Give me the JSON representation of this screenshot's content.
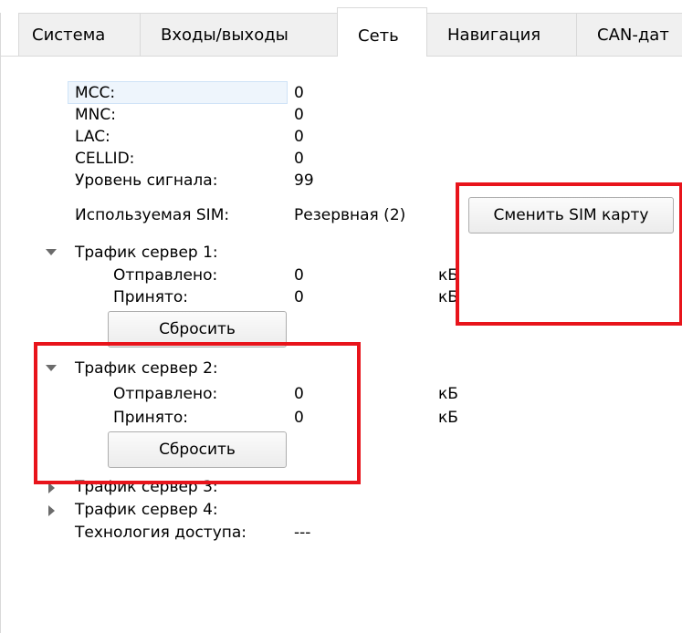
{
  "tabs": [
    {
      "label": "Система",
      "active": false
    },
    {
      "label": "Входы/выходы",
      "active": false
    },
    {
      "label": "Сеть",
      "active": true
    },
    {
      "label": "Навигация",
      "active": false
    },
    {
      "label": "CAN-дат",
      "active": false
    }
  ],
  "network": {
    "mcc": {
      "label": "MCC:",
      "value": "0"
    },
    "mnc": {
      "label": "MNC:",
      "value": "0"
    },
    "lac": {
      "label": "LAC:",
      "value": "0"
    },
    "cellid": {
      "label": "CELLID:",
      "value": "0"
    },
    "signal": {
      "label": "Уровень сигнала:",
      "value": "99"
    },
    "sim": {
      "label": "Используемая SIM:",
      "value": "Резервная (2)",
      "button": "Сменить SIM карту"
    }
  },
  "traffic": [
    {
      "title": "Трафик сервер 1:",
      "expanded": true,
      "sent_label": "Отправлено:",
      "sent_value": "0",
      "sent_unit": "кБ",
      "recv_label": "Принято:",
      "recv_value": "0",
      "recv_unit": "кБ",
      "reset": "Сбросить"
    },
    {
      "title": "Трафик сервер 2:",
      "expanded": true,
      "sent_label": "Отправлено:",
      "sent_value": "0",
      "sent_unit": "кБ",
      "recv_label": "Принято:",
      "recv_value": "0",
      "recv_unit": "кБ",
      "reset": "Сбросить"
    },
    {
      "title": "Трафик сервер 3:",
      "expanded": false
    },
    {
      "title": "Трафик сервер 4:",
      "expanded": false
    }
  ],
  "access_tech": {
    "label": "Технология доступа:",
    "value": "---"
  },
  "colors": {
    "highlight": "#e8141b",
    "arrow": "#6b6b6b",
    "tab_border": "#d9d9d9"
  }
}
